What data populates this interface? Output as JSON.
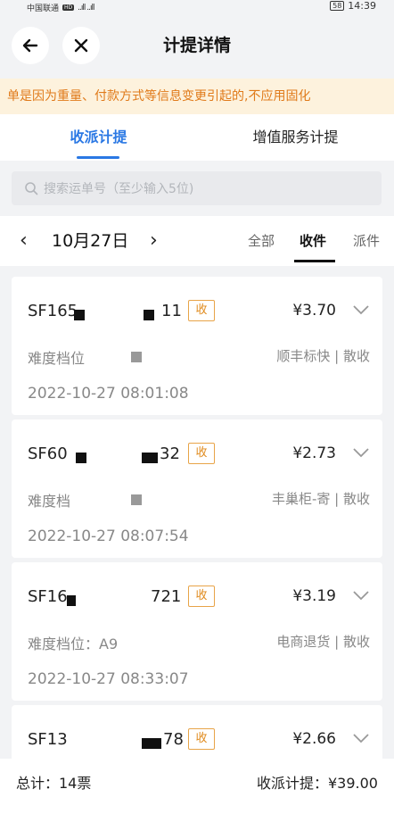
{
  "status_bar": {
    "carrier": "中国联通",
    "hd": "HD",
    "signal": "..ıll ..ıll",
    "battery": "58",
    "time": "14:39"
  },
  "header": {
    "title": "计提详情",
    "back_icon": "arrow-left-icon",
    "close_icon": "close-icon"
  },
  "notice": {
    "text": "单是因为重量、付款方式等信息变更引起的,不应用固化"
  },
  "tabs": [
    {
      "label": "收派计提",
      "active": true
    },
    {
      "label": "增值服务计提",
      "active": false
    }
  ],
  "search": {
    "placeholder": "搜索运单号（至少输入5位)"
  },
  "date_bar": {
    "prev": "‹",
    "date": "10月27日",
    "next": "›",
    "filters": [
      {
        "label": "全部",
        "active": false
      },
      {
        "label": "收件",
        "active": true
      },
      {
        "label": "派件",
        "active": false
      }
    ]
  },
  "records": [
    {
      "waybill_prefix": "SF165",
      "waybill_suffix": "11",
      "badge": "收",
      "price": "¥3.70",
      "level": "难度档位",
      "tags": "顺丰标快 | 散收",
      "time": "2022-10-27 08:01:08"
    },
    {
      "waybill_prefix": "SF60",
      "waybill_suffix": "32",
      "badge": "收",
      "price": "¥2.73",
      "level": "难度档",
      "tags": "丰巢柜-寄 | 散收",
      "time": "2022-10-27 08:07:54"
    },
    {
      "waybill_prefix": "SF16",
      "waybill_suffix": "721",
      "badge": "收",
      "price": "¥3.19",
      "level": "难度档位：A9",
      "tags": "电商退货 | 散收",
      "time": "2022-10-27 08:33:07"
    },
    {
      "waybill_prefix": "SF13",
      "waybill_suffix": "78",
      "badge": "收",
      "price": "¥2.66",
      "level": "",
      "tags": "",
      "time": ""
    }
  ],
  "footer": {
    "total": "总计：14票",
    "sum": "收派计提：¥39.00"
  }
}
